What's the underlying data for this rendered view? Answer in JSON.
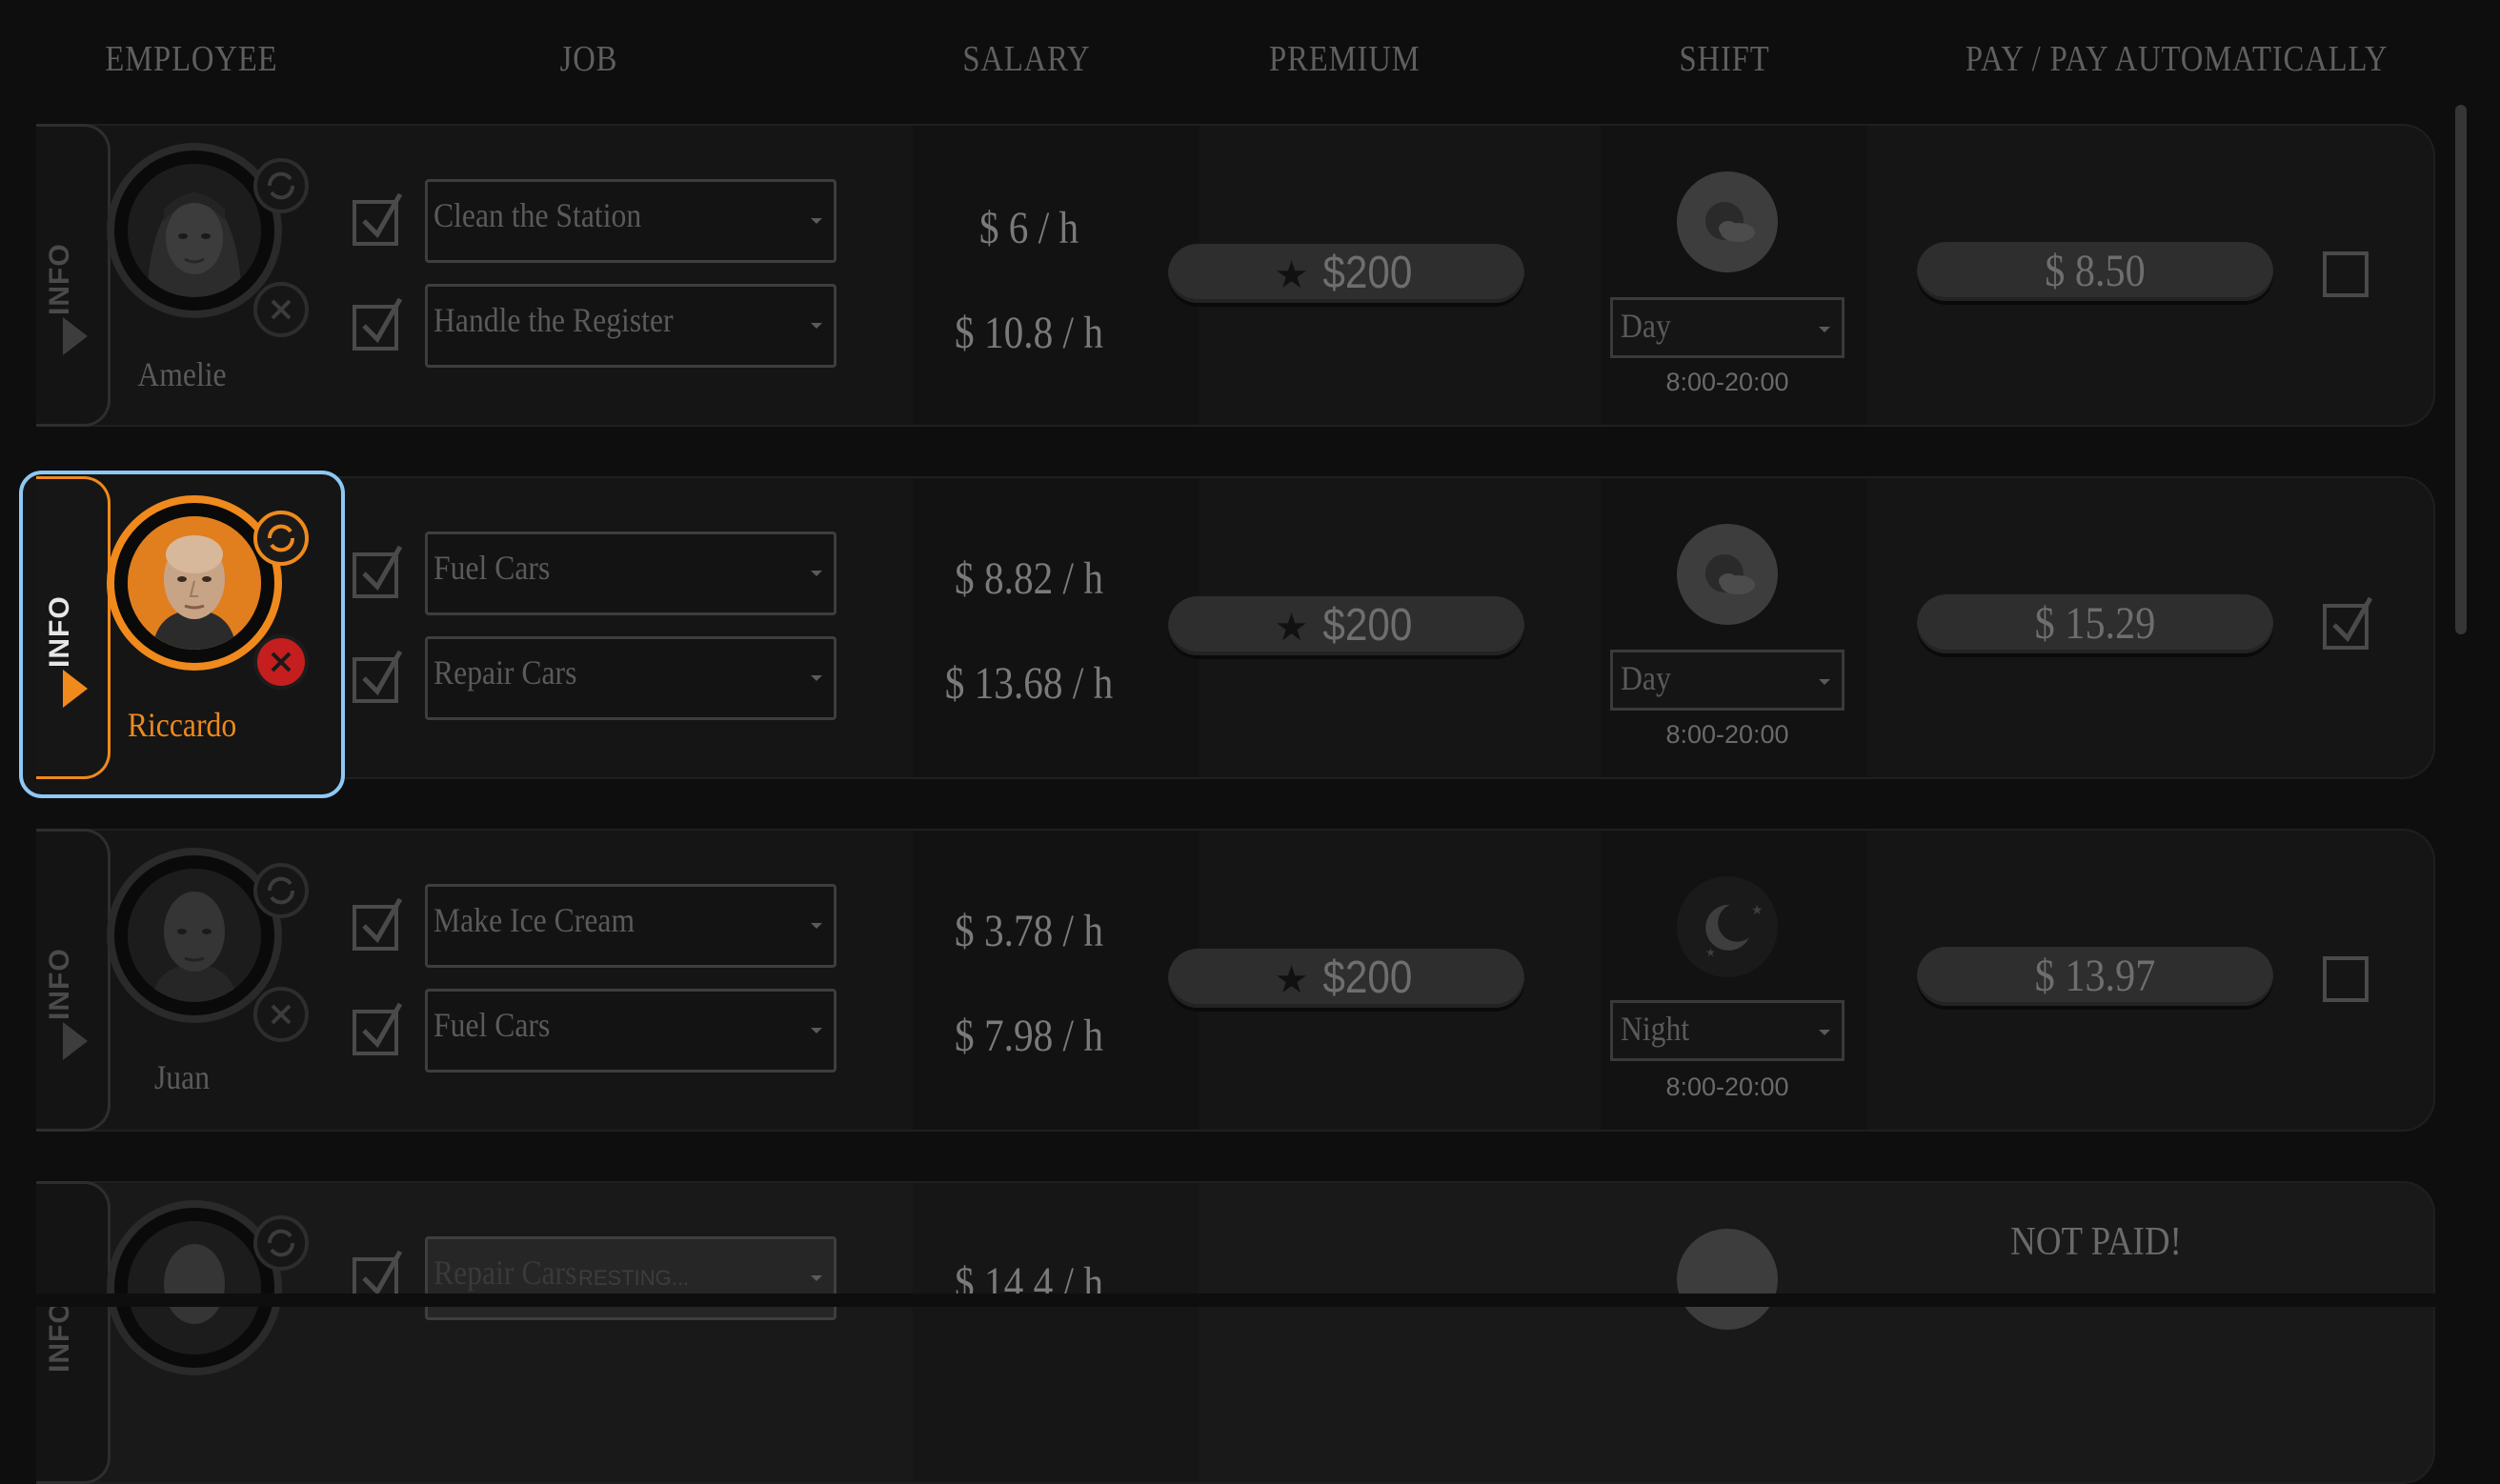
{
  "headers": {
    "employee": "EMPLOYEE",
    "job": "JOB",
    "salary": "SALARY",
    "premium": "PREMIUM",
    "shift": "SHIFT",
    "pay": "PAY / PAY AUTOMATICALLY"
  },
  "info_label": "INFO",
  "employees": [
    {
      "name": "Amelie",
      "jobs": [
        "Clean the Station",
        "Handle the Register"
      ],
      "salaries": [
        "$ 6 / h",
        "$ 10.8 / h"
      ],
      "premium": "$200",
      "shift": "Day",
      "shift_icon": "day-moon-cloud-icon",
      "hours": "8:00-20:00",
      "pay": "$ 8.50",
      "pay_automatically": false
    },
    {
      "name": "Riccardo",
      "jobs": [
        "Fuel Cars",
        "Repair Cars"
      ],
      "salaries": [
        "$ 8.82 / h",
        "$ 13.68 / h"
      ],
      "premium": "$200",
      "shift": "Day",
      "shift_icon": "day-moon-cloud-icon",
      "hours": "8:00-20:00",
      "pay": "$ 15.29",
      "pay_automatically": true,
      "selected": true
    },
    {
      "name": "Juan",
      "jobs": [
        "Make Ice Cream",
        "Fuel Cars"
      ],
      "salaries": [
        "$ 3.78 / h",
        "$ 7.98 / h"
      ],
      "premium": "$200",
      "shift": "Night",
      "shift_icon": "night-moon-stars-icon",
      "hours": "8:00-20:00",
      "pay": "$ 13.97",
      "pay_automatically": false
    },
    {
      "name": "",
      "jobs": [
        "Repair Cars"
      ],
      "job_status": "RESTING...",
      "salaries": [
        "$ 14.4 / h"
      ],
      "status": "NOT PAID!"
    }
  ],
  "colors": {
    "accent_orange": "#f08a1c",
    "selection_blue": "#8ec8f4",
    "fire_red": "#c41e1e"
  }
}
